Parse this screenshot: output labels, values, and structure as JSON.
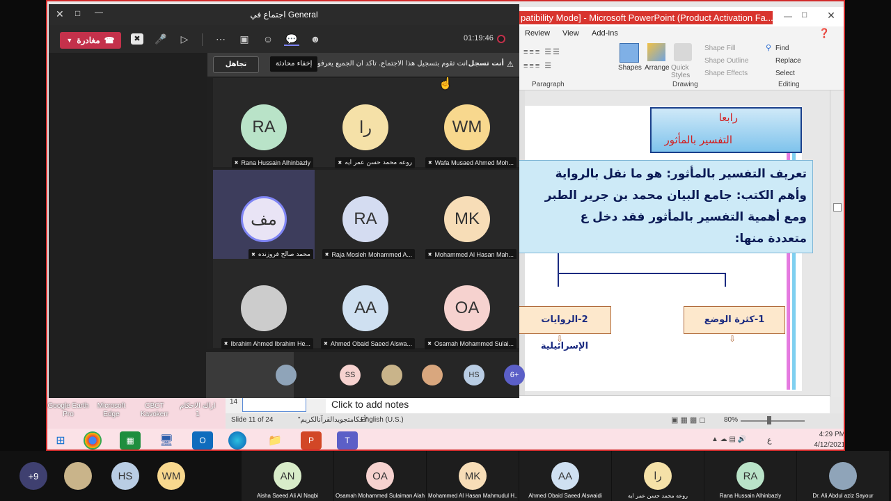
{
  "teams": {
    "window_title": "اجتماع في General",
    "leave_label": "مغادرة",
    "timer": "01:19:46",
    "tooltip": "إخفاء محادثة",
    "rec_bold": "أنت تسجل",
    "rec_text": "أنت تقوم بتسجيل هذا الاجتماع. تأكد أن الجميع يعرفون أنه",
    "dismiss_label": "تجاهل",
    "participants": [
      {
        "initials": "RA",
        "name": "Rana Hussain Alhinbazly",
        "color": "#b9e3c8"
      },
      {
        "initials": "را",
        "name": "روعه محمد حسن عمر ايه",
        "color": "#f5e1a8"
      },
      {
        "initials": "WM",
        "name": "Wafa Musaed Ahmed Moh...",
        "color": "#f8d88e"
      },
      {
        "initials": "مف",
        "name": "محمد صالح فروزنده",
        "color": "#e9e4f5"
      },
      {
        "initials": "RA",
        "name": "Raja Mosleh Mohammed A...",
        "color": "#d4dcf1"
      },
      {
        "initials": "MK",
        "name": "Mohammed Al Hasan Mah...",
        "color": "#f7ddb7"
      },
      {
        "initials": "",
        "name": "Ibrahim Ahmed Ibrahim He...",
        "color": "#cccccc"
      },
      {
        "initials": "AA",
        "name": "Ahmed Obaid Saeed Alswa...",
        "color": "#cfe0f1"
      },
      {
        "initials": "OA",
        "name": "Osamah Mohammed Sulai...",
        "color": "#f6d2cf"
      }
    ],
    "strip": [
      {
        "initials": "",
        "color": "#8fa4b9"
      },
      {
        "initials": "SS",
        "color": "#f6d2cf"
      },
      {
        "initials": "",
        "color": "#c9b48a"
      },
      {
        "initials": "",
        "color": "#d9a77e"
      },
      {
        "initials": "HS",
        "color": "#b9cde4"
      },
      {
        "initials": "6+",
        "color": "#5b5fc7"
      }
    ]
  },
  "ppt": {
    "title": "patibility Mode] - Microsoft PowerPoint (Product Activation Fa...",
    "tabs": [
      "Review",
      "View",
      "Add-Ins"
    ],
    "find": "Find",
    "replace": "Replace",
    "select": "Select",
    "shape_fill": "Shape Fill",
    "shape_outline": "Shape Outline",
    "shape_effects": "Shape Effects",
    "shapes": "Shapes",
    "arrange": "Arrange",
    "quick_styles": "Quick Styles",
    "group_paragraph": "Paragraph",
    "group_drawing": "Drawing",
    "group_editing": "Editing",
    "slide_title1": "رابعا",
    "slide_title2": "التفسير بالمأثور",
    "text_l1": "تعريف التفسير بالمأثور: هو ما نقل بالرواية",
    "text_l2": "وأهم الكتب: جامع البيان محمد بن جرير الطبر",
    "text_l3": "ومع أهمية التفسير بالمأثور فقد دخل ع",
    "text_l4": "متعددة منها:",
    "box1": "1-كثرة الوضع",
    "box2": "2-الروايات الإسرائيلية",
    "notes": "Click to add notes",
    "slide_num": "14",
    "status_slide": "Slide 11 of 24",
    "status_theme": "\"أحكامتجويدالقرآنالكريم\"",
    "status_lang": "English (U.S.)",
    "zoom": "80%"
  },
  "desktop": {
    "icons": [
      "Google Earth Pro",
      "Microsoft Edge",
      "CBCT Kavokerr",
      "ازالة الاحكام 1"
    ],
    "clock_time": "4:29 PM",
    "clock_date": "4/12/2021",
    "lang": "ع"
  },
  "gallery": {
    "more": "+9",
    "small": [
      {
        "initials": "",
        "color": "#c9b48a"
      },
      {
        "initials": "HS",
        "color": "#b9cde4"
      },
      {
        "initials": "WM",
        "color": "#f8d88e"
      },
      {
        "initials": "",
        "color": "#ffffff"
      }
    ],
    "tiles": [
      {
        "initials": "AN",
        "name": "Aisha Saeed Ali Al Naqbi",
        "color": "#d8ecc9"
      },
      {
        "initials": "OA",
        "name": "Osamah Mohammed Sulaiman Alah...",
        "color": "#f6d2cf"
      },
      {
        "initials": "MK",
        "name": "Mohammed Al Hasan Mahmudul H...",
        "color": "#f7ddb7"
      },
      {
        "initials": "AA",
        "name": "Ahmed Obaid Saeed Alswaidi",
        "color": "#cfe0f1"
      },
      {
        "initials": "را",
        "name": "روعه محمد حسن عمر ايه",
        "color": "#f5e1a8"
      },
      {
        "initials": "RA",
        "name": "Rana Hussain Alhinbazly",
        "color": "#b9e3c8"
      },
      {
        "initials": "",
        "name": "Dr. Ali Abdul aziz Sayour",
        "color": "#8fa4b9"
      }
    ]
  }
}
